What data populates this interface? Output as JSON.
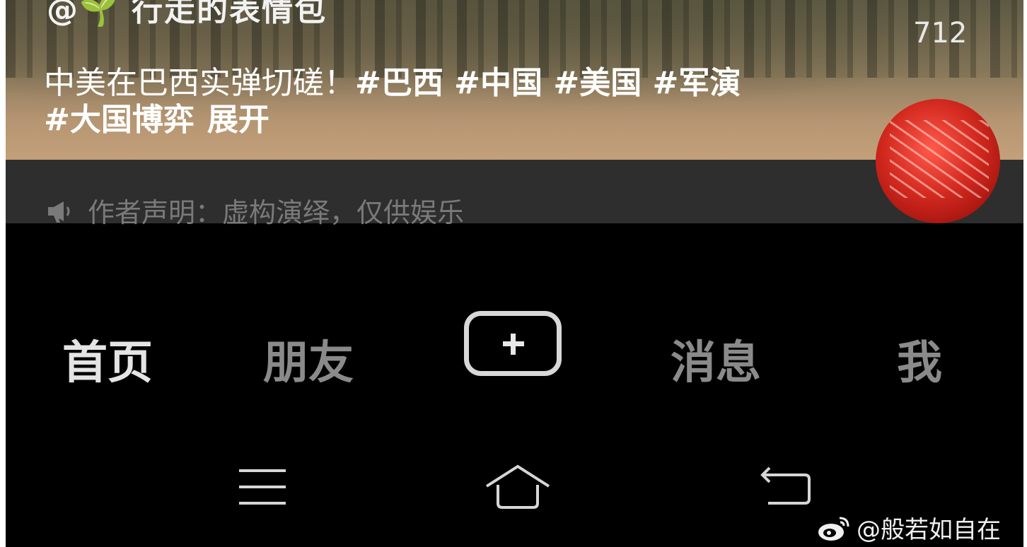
{
  "video": {
    "author": "@🌱 行走的表情包",
    "count": "712",
    "description": "中美在巴西实弹切磋！",
    "tags": "#巴西 #中国 #美国 #军演 #大国博弈",
    "expand": "展开",
    "notice": "作者声明：虚构演绎，仅供娱乐"
  },
  "tabbar": {
    "home": "首页",
    "friends": "朋友",
    "messages": "消息",
    "me": "我"
  },
  "watermark": "@般若如自在",
  "colors": {
    "tab_active": "#e4e4e4",
    "tab_inactive": "#8a8a8a",
    "caption_bar": "#2e2e2e",
    "avatar_red": "#d42a20"
  }
}
